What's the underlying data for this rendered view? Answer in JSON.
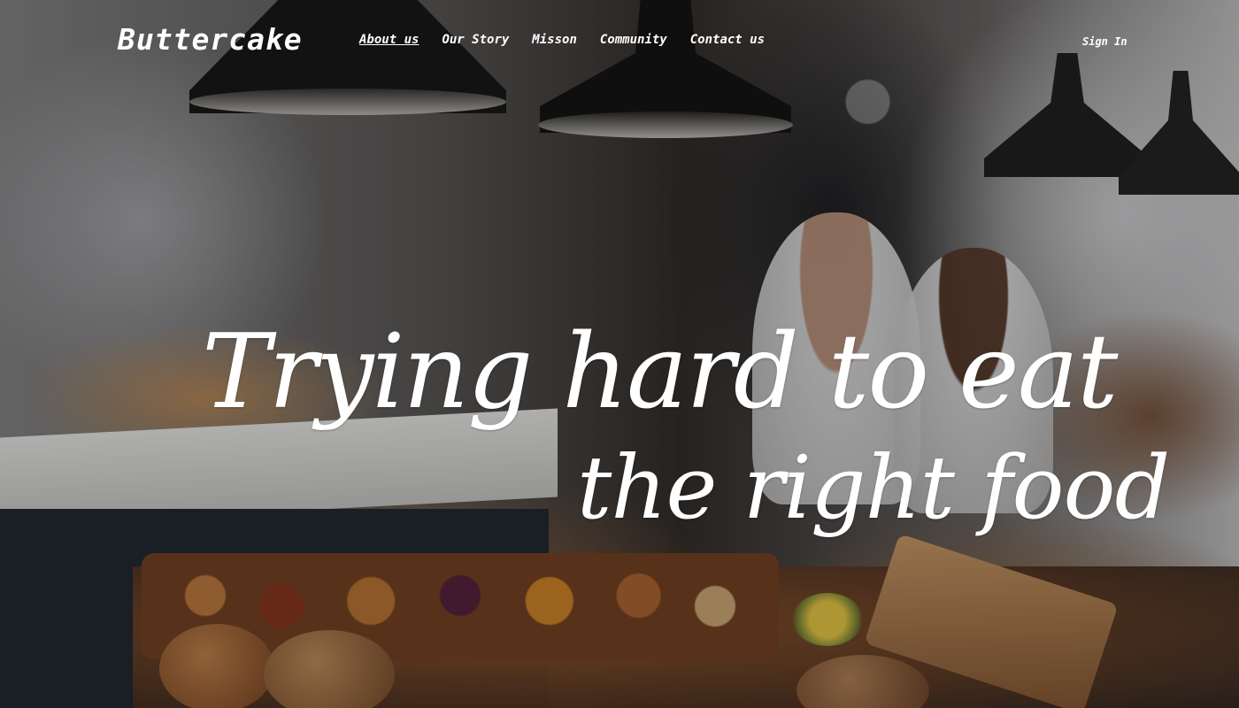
{
  "brand": {
    "logo_text": "Buttercake"
  },
  "nav": {
    "items": [
      {
        "label": "About us",
        "active": true
      },
      {
        "label": "Our Story",
        "active": false
      },
      {
        "label": "Misson",
        "active": false
      },
      {
        "label": "Community",
        "active": false
      },
      {
        "label": "Contact us",
        "active": false
      }
    ],
    "signin_label": "Sign In"
  },
  "hero": {
    "headline_line1": "Trying hard to eat",
    "headline_line2": "the right food",
    "background_scene": "bakery counter with bread and pastries"
  },
  "colors": {
    "text": "#ffffff",
    "overlay": "#000000"
  }
}
